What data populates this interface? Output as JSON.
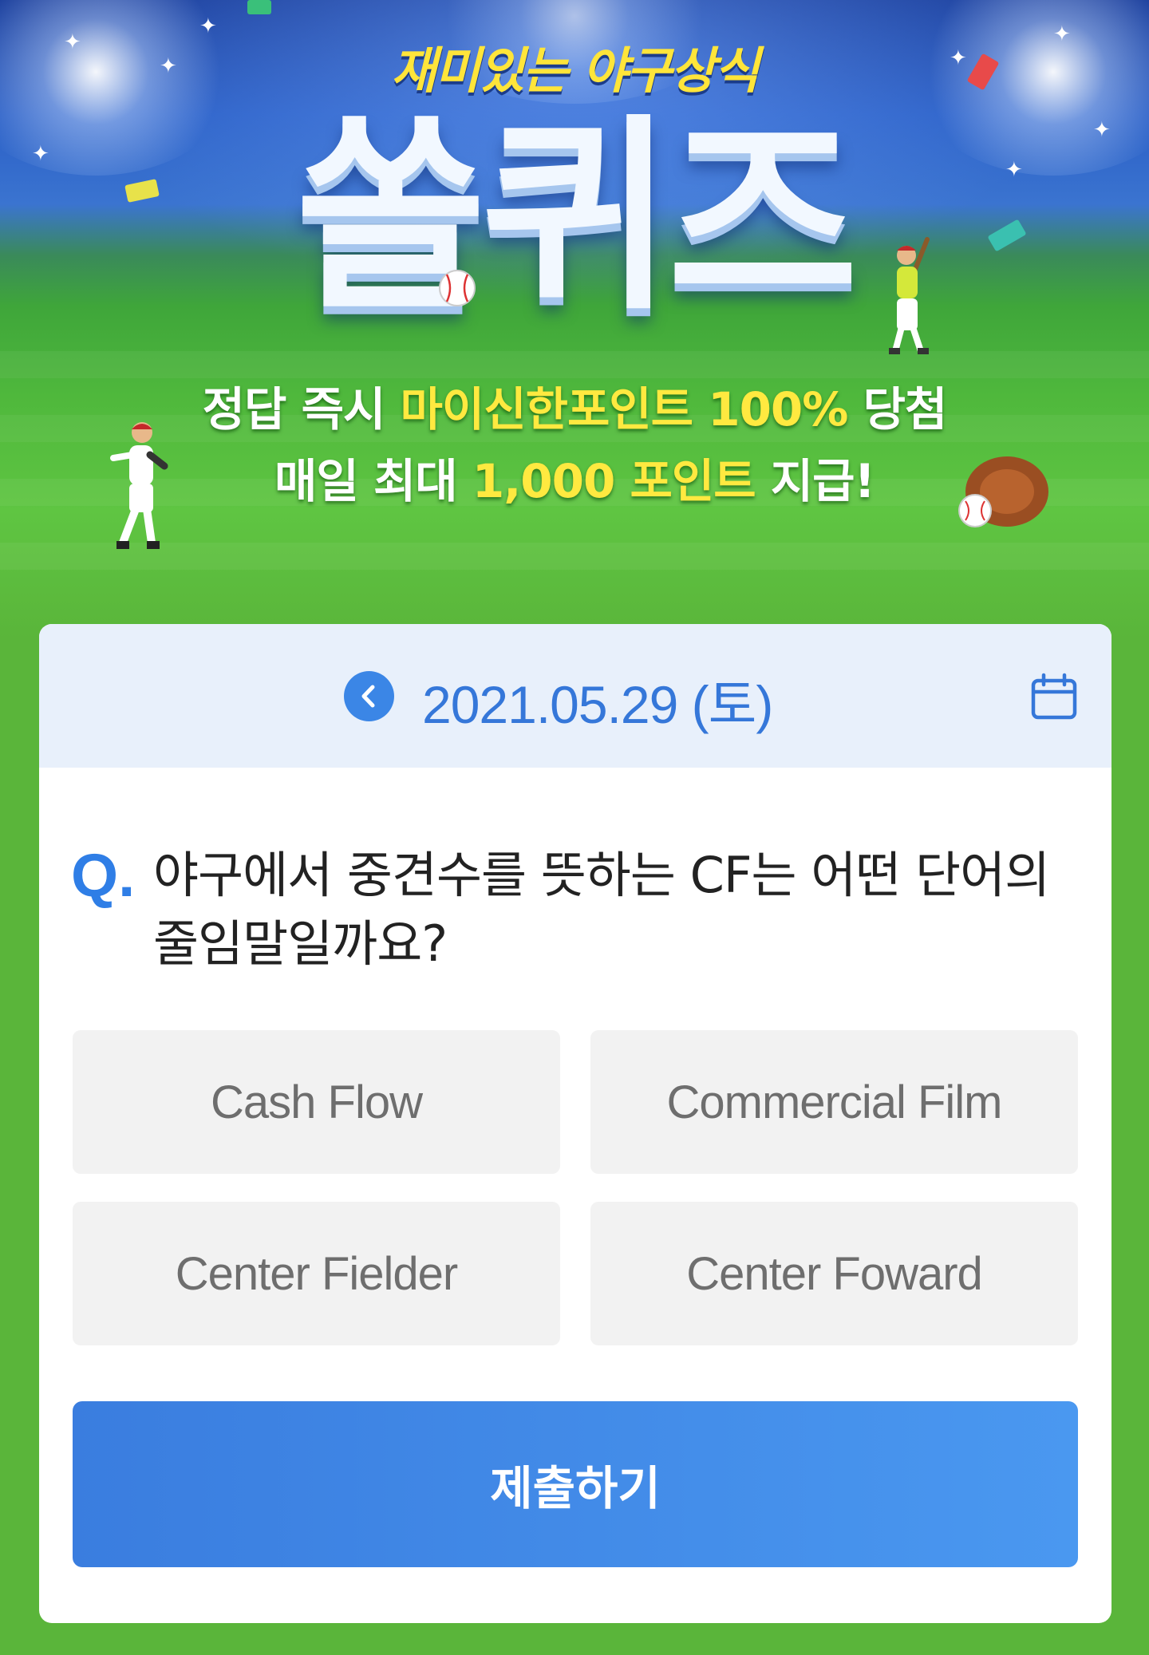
{
  "hero": {
    "subtitle": "재미있는 야구상식",
    "title": "쏠퀴즈",
    "line1_prefix": "정답 즉시 ",
    "line1_highlight": "마이신한포인트 100%",
    "line1_suffix": " 당첨",
    "line2_prefix": "매일 최대 ",
    "line2_highlight": "1,000 포인트",
    "line2_suffix": " 지급!"
  },
  "quiz": {
    "date": "2021.05.29 (토)",
    "question_mark": "Q.",
    "question": "야구에서 중견수를 뜻하는 CF는 어떤 단어의 줄임말일까요?",
    "options": [
      {
        "label": "Cash Flow"
      },
      {
        "label": "Commercial Film"
      },
      {
        "label": "Center Fielder"
      },
      {
        "label": "Center Foward"
      }
    ],
    "submit_label": "제출하기"
  },
  "colors": {
    "accent": "#3b86e6",
    "header_bg": "#e8f0fb",
    "option_bg": "#f2f2f2",
    "page_bg": "#5ab53a",
    "highlight": "#ffe940"
  },
  "icons": {
    "prev": "chevron-left-icon",
    "calendar": "calendar-icon"
  }
}
